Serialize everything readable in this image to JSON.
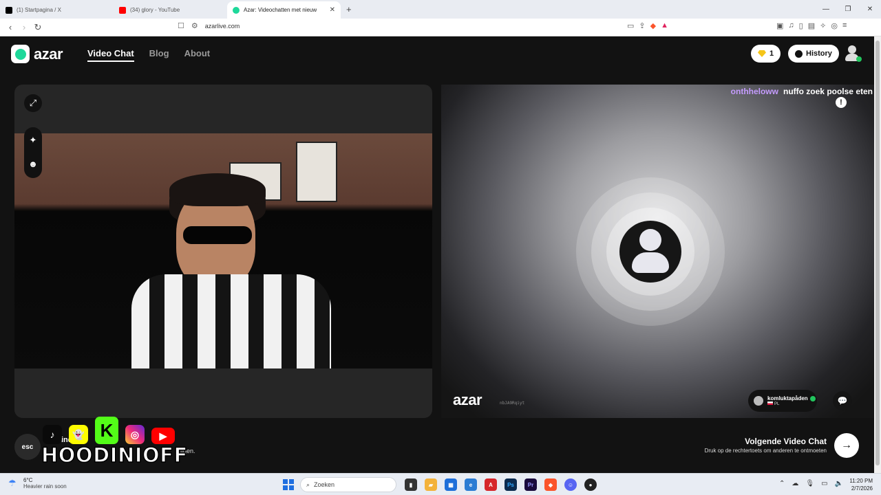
{
  "browser": {
    "tabs": [
      {
        "title": "(1) Startpagina / X",
        "favicon_color": "#000000"
      },
      {
        "title": "(34) glory - YouTube",
        "favicon_color": "#ff0000"
      },
      {
        "title": "Azar: Videochatten met nieuw",
        "favicon_color": "#1ed89a",
        "active": true
      }
    ],
    "url": "azarlive.com"
  },
  "site": {
    "logo": "azar",
    "nav": [
      {
        "label": "Video Chat",
        "active": true
      },
      {
        "label": "Blog"
      },
      {
        "label": "About"
      }
    ],
    "gems_count": "1",
    "history_label": "History"
  },
  "partner": {
    "chat_username": "onthheloww",
    "chat_message": "nuffo zoek poolse eten",
    "watermark": "azar",
    "watermark_id": "nbJA9Rqiyt",
    "name": "komluktapåden",
    "country": "PL"
  },
  "controls": {
    "esc_label": "esc",
    "hint_start": "ind",
    "hint_end": "ligen.",
    "next_title": "Volgende Video Chat",
    "next_subtitle": "Druk op de rechtertoets om anderen te ontmoeten"
  },
  "overlay": {
    "brand": "HOODINIOFF",
    "socials": [
      "tiktok",
      "snapchat",
      "kick",
      "instagram",
      "youtube"
    ]
  },
  "taskbar": {
    "temperature": "6°C",
    "weather": "Heavier rain soon",
    "search_placeholder": "Zoeken",
    "time": "11:20 PM",
    "date": "2/7/2026"
  },
  "colors": {
    "accent": "#1ed89a",
    "chat_user": "#c59cff",
    "verified": "#22c55e"
  }
}
